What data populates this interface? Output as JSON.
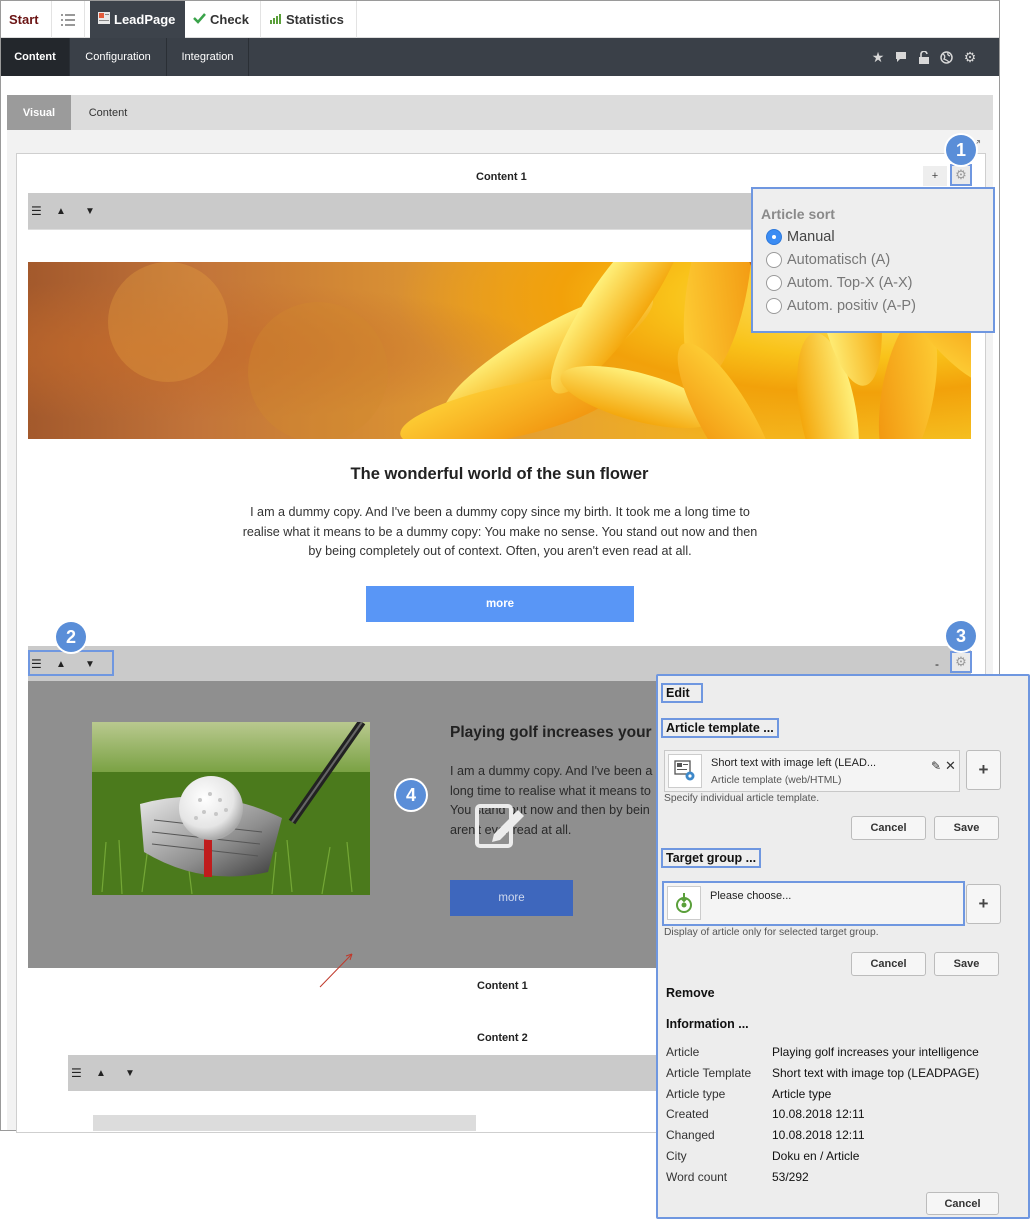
{
  "top_tabs": {
    "start": "Start",
    "leadpage": "LeadPage",
    "check": "Check",
    "statistics": "Statistics"
  },
  "menu": {
    "content": "Content",
    "configuration": "Configuration",
    "integration": "Integration",
    "tool_icons": [
      "star-icon",
      "comment-icon",
      "unlock-icon",
      "globe-icon",
      "gear-icon"
    ]
  },
  "sub_tabs": {
    "visual": "Visual",
    "content": "Content"
  },
  "canvas": {
    "section1_label": "Content 1",
    "plus_label": "+",
    "minus_label": "-",
    "section1_footer_label": "Content 1",
    "section2_label": "Content 2"
  },
  "article1": {
    "title": "The wonderful world of the sun flower",
    "text": "I am a dummy copy. And I've been a dummy copy since my birth. It took me a long time to realise what it means to be a dummy copy: You make no sense. You stand out now and then by being completely out of context. Often, you aren't even read at all.",
    "button": "more"
  },
  "article2": {
    "title": "Playing golf increases your",
    "text_lines": [
      "I am a dummy copy. And I've been a",
      "long time to realise what it means to",
      "You stand out now and then by bein",
      "aren't ever read at all."
    ],
    "button": "more"
  },
  "badges": [
    "1",
    "2",
    "3",
    "4"
  ],
  "article_sort": {
    "title": "Article sort",
    "options": [
      "Manual",
      "Automatisch (A)",
      "Autom. Top-X (A-X)",
      "Autom. positiv (A-P)"
    ],
    "selected": "Manual"
  },
  "edit_panel": {
    "edit_label": "Edit",
    "template_head": "Article template ...",
    "template_name": "Short text with image left (LEAD...",
    "template_type": "Article template (web/HTML)",
    "template_hint": "Specify individual article template.",
    "cancel": "Cancel",
    "save": "Save",
    "plus": "+",
    "target_head": "Target group ...",
    "target_placeholder": "Please choose...",
    "target_hint": "Display of article only for selected target group.",
    "remove": "Remove",
    "info_head": "Information ...",
    "info": [
      {
        "key": "Article",
        "value": "Playing golf increases your intelligence"
      },
      {
        "key": "Article Template",
        "value": "Short text with image top (LEADPAGE)"
      },
      {
        "key": "Article type",
        "value": "Article type"
      },
      {
        "key": "Created",
        "value": "10.08.2018 12:11"
      },
      {
        "key": "Changed",
        "value": "10.08.2018 12:11"
      },
      {
        "key": "City",
        "value": "Doku en / Article"
      },
      {
        "key": "Word count",
        "value": "53/292"
      }
    ],
    "bottom_cancel": "Cancel"
  },
  "colors": {
    "menu_bar": "#3a4048",
    "accent_blue": "#5996f6",
    "badge_blue": "#5a8ed8",
    "highlight_border": "#6f97e0"
  }
}
